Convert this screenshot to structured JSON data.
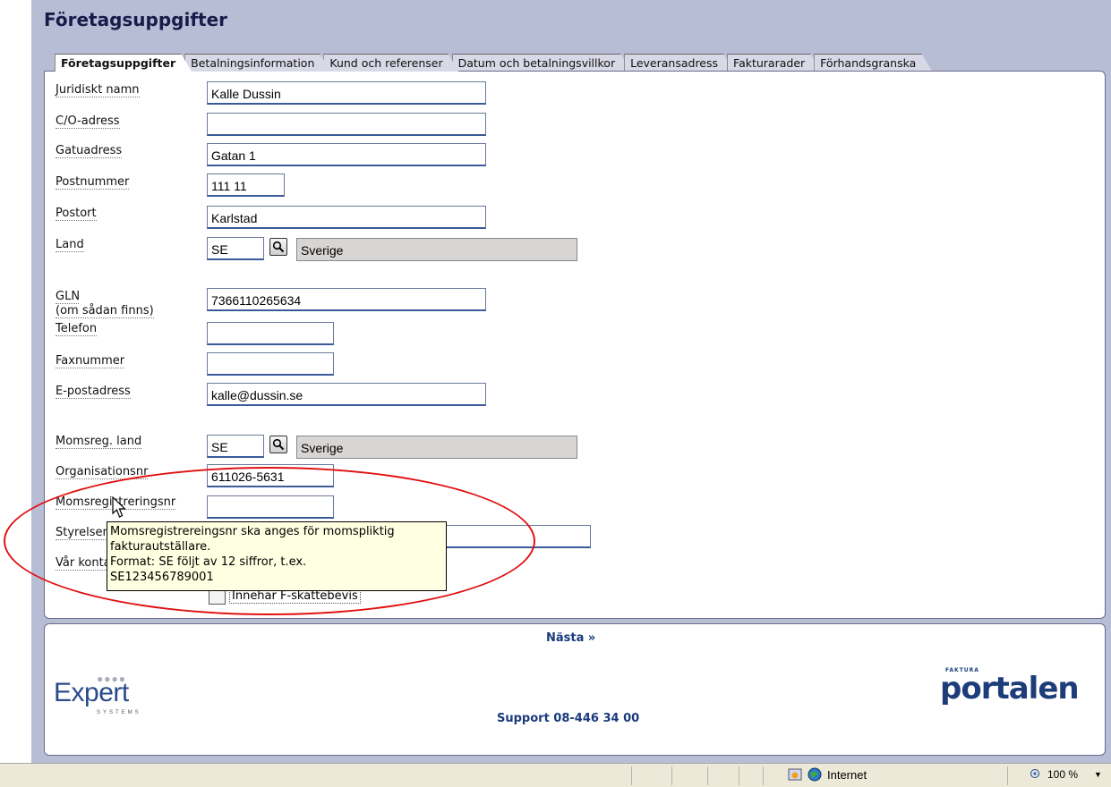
{
  "page": {
    "title": "Företagsuppgifter"
  },
  "tabs": [
    {
      "label": "Företagsuppgifter",
      "active": true
    },
    {
      "label": "Betalningsinformation"
    },
    {
      "label": "Kund och referenser"
    },
    {
      "label": "Datum och betalningsvillkor"
    },
    {
      "label": "Leveransadress"
    },
    {
      "label": "Fakturarader"
    },
    {
      "label": "Förhandsgranska"
    }
  ],
  "form": {
    "juridiskt_namn": {
      "label": "Juridiskt namn",
      "value": "Kalle Dussin"
    },
    "co_adress": {
      "label": "C/O-adress",
      "value": ""
    },
    "gatuadress": {
      "label": "Gatuadress",
      "value": "Gatan 1"
    },
    "postnummer": {
      "label": "Postnummer",
      "value": "111 11"
    },
    "postort": {
      "label": "Postort",
      "value": "Karlstad"
    },
    "land": {
      "label": "Land",
      "code": "SE",
      "name": "Sverige"
    },
    "gln": {
      "label_line1": "GLN",
      "label_line2": "(om sådan finns)",
      "value": "7366110265634"
    },
    "telefon": {
      "label": "Telefon",
      "value": ""
    },
    "faxnummer": {
      "label": "Faxnummer",
      "value": ""
    },
    "epost": {
      "label": "E-postadress",
      "value": "kalle@dussin.se"
    },
    "momsreg_land": {
      "label": "Momsreg. land",
      "code": "SE",
      "name": "Sverige"
    },
    "organisationsnr": {
      "label": "Organisationsnr",
      "value": "611026-5631"
    },
    "momsregnr": {
      "label": "Momsregistreringsnr",
      "value": ""
    },
    "styrelsens_sate": {
      "label": "Styrelsens sä",
      "value": ""
    },
    "kontaktperson": {
      "label": "Vår kontaktp",
      "value": ""
    },
    "fskatt": {
      "label": "Innehar F-skattebevis",
      "checked": false
    }
  },
  "tooltip": {
    "line1": "Momsregistrereingsnr ska anges för momspliktig",
    "line2": "fakturautställare.",
    "line3": "Format: SE följt av 12 siffror, t.ex.",
    "line4": "SE123456789001"
  },
  "footer": {
    "next_label": "Nästa »",
    "support": "Support 08-446 34 00",
    "logo_left": "Expert",
    "logo_left_sub": "SYSTEMS",
    "logo_right": "portalen",
    "logo_right_sup": "FAKTURA"
  },
  "statusbar": {
    "zone": "Internet",
    "zoom": "100 %"
  },
  "colors": {
    "accent": "#1a3a7a",
    "annotation": "#e01010",
    "tooltip_bg": "#ffffe1"
  }
}
